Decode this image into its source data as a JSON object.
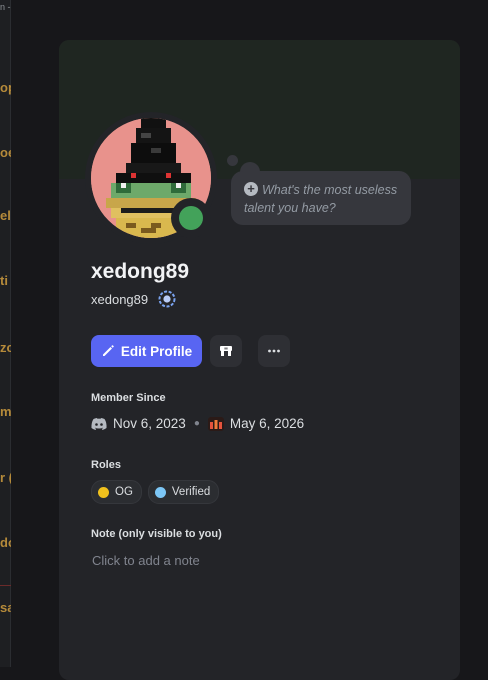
{
  "left_column": {
    "top_fragment": "n -",
    "fragments": [
      "op",
      "oe",
      "el",
      "ti",
      "zc",
      "m",
      "r (",
      "do",
      "sa"
    ]
  },
  "profile": {
    "display_name": "xedong89",
    "username": "xedong89",
    "status": "online",
    "status_color": "#43a25a",
    "custom_status_placeholder": "What's the most useless talent you have?",
    "add_status_icon": "plus-circle-icon"
  },
  "actions": {
    "edit_profile_label": "Edit Profile",
    "game_icon": "controller-icon",
    "more_icon": "ellipsis-icon",
    "accent": "#5865f2"
  },
  "member_since": {
    "title": "Member Since",
    "discord_date": "Nov 6, 2023",
    "server_date": "May 6, 2026"
  },
  "roles": {
    "title": "Roles",
    "items": [
      {
        "name": "OG",
        "color": "#f0c11d"
      },
      {
        "name": "Verified",
        "color": "#7cc6f5"
      }
    ]
  },
  "note": {
    "title": "Note (only visible to you)",
    "placeholder": "Click to add a note"
  }
}
